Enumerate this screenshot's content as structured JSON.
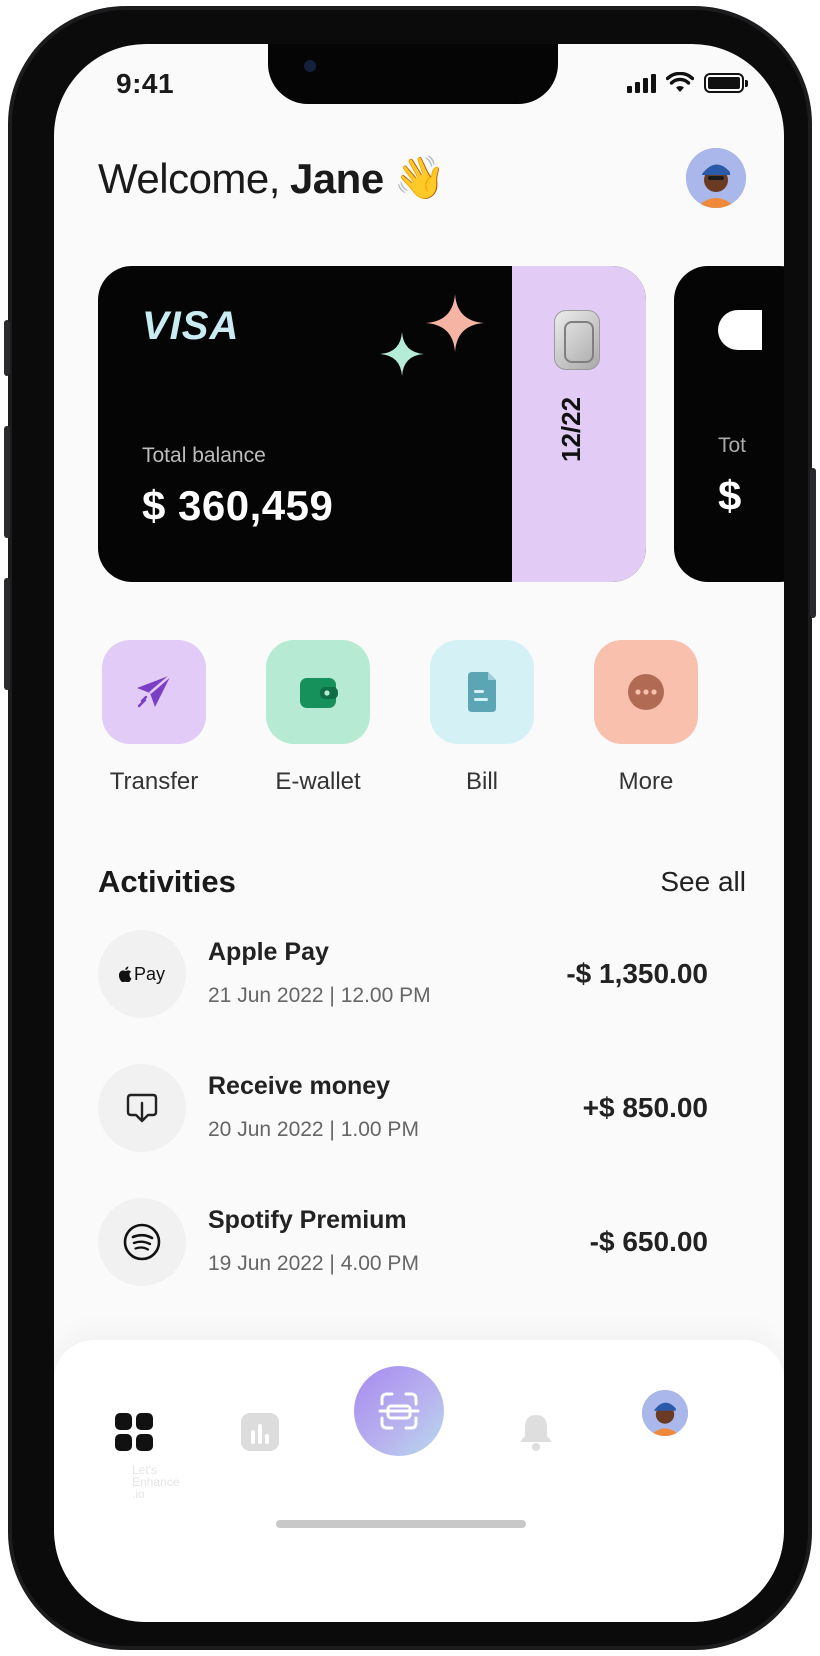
{
  "status_bar": {
    "time": "9:41"
  },
  "header": {
    "greeting": "Welcome,",
    "name": "Jane",
    "emoji": "👋"
  },
  "card": {
    "brand": "VISA",
    "balance_label": "Total balance",
    "balance": "$ 360,459",
    "expiry": "12/22",
    "peek_label": "Tot",
    "peek_balance": "$"
  },
  "actions": [
    {
      "label": "Transfer",
      "icon": "paper-plane-icon",
      "color": "#e2cbf6"
    },
    {
      "label": "E-wallet",
      "icon": "wallet-icon",
      "color": "#b7ead2"
    },
    {
      "label": "Bill",
      "icon": "document-icon",
      "color": "#d4f1f6"
    },
    {
      "label": "More",
      "icon": "more-dots-icon",
      "color": "#f8c0ad"
    }
  ],
  "activities": {
    "title": "Activities",
    "see_all": "See all",
    "items": [
      {
        "name": "Apple Pay",
        "date": "21 Jun 2022 | 12.00 PM",
        "amount": "-$ 1,350.00",
        "icon": "apple-pay-icon",
        "icon_text": "Pay"
      },
      {
        "name": "Receive money",
        "date": "20 Jun 2022 | 1.00 PM",
        "amount": "+$ 850.00",
        "icon": "download-icon"
      },
      {
        "name": "Spotify Premium",
        "date": "19 Jun 2022 | 4.00 PM",
        "amount": "-$ 650.00",
        "icon": "spotify-icon"
      }
    ]
  },
  "bottom_nav": [
    "home-grid-icon",
    "chart-icon",
    "scan-icon",
    "bell-icon",
    "avatar"
  ],
  "watermark": [
    "Let's",
    "Enhance",
    ".io"
  ],
  "colors": {
    "card": "#050505",
    "visa_text": "#c9ecf3",
    "card_side": "#e2ccf5",
    "sparkle_peach": "#f6b4a4",
    "sparkle_mint": "#b4ecd8"
  }
}
